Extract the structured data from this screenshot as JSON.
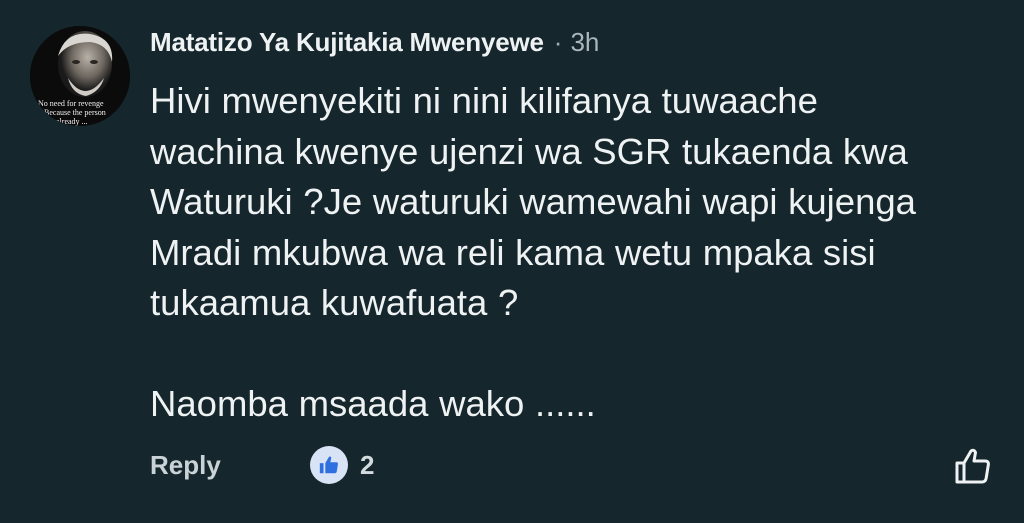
{
  "comment": {
    "avatar_icon": "profile-photo",
    "avatar_caption_lines": [
      "No need for revenge",
      "Because the person",
      "already ..."
    ],
    "author": "Matatizo Ya Kujitakia Mwenyewe",
    "separator": "·",
    "time": "3h",
    "text": "Hivi mwenyekiti ni nini kilifanya tuwaache\nwachina kwenye ujenzi wa SGR tukaenda kwa\nWaturuki ?Je waturuki wamewahi wapi kujenga\nMradi mkubwa wa reli kama wetu mpaka sisi\ntukaamua kuwafuata ?\n\nNaomba msaada wako ......"
  },
  "actions": {
    "reply_label": "Reply",
    "reaction_icon": "thumbs-up-icon",
    "reaction_count": "2",
    "like_icon": "thumbs-up-outline-icon"
  },
  "colors": {
    "background": "#15262d",
    "text": "#eef2f3",
    "reaction_badge": "#d9e3f6",
    "reaction_thumb": "#2f6fe0"
  }
}
